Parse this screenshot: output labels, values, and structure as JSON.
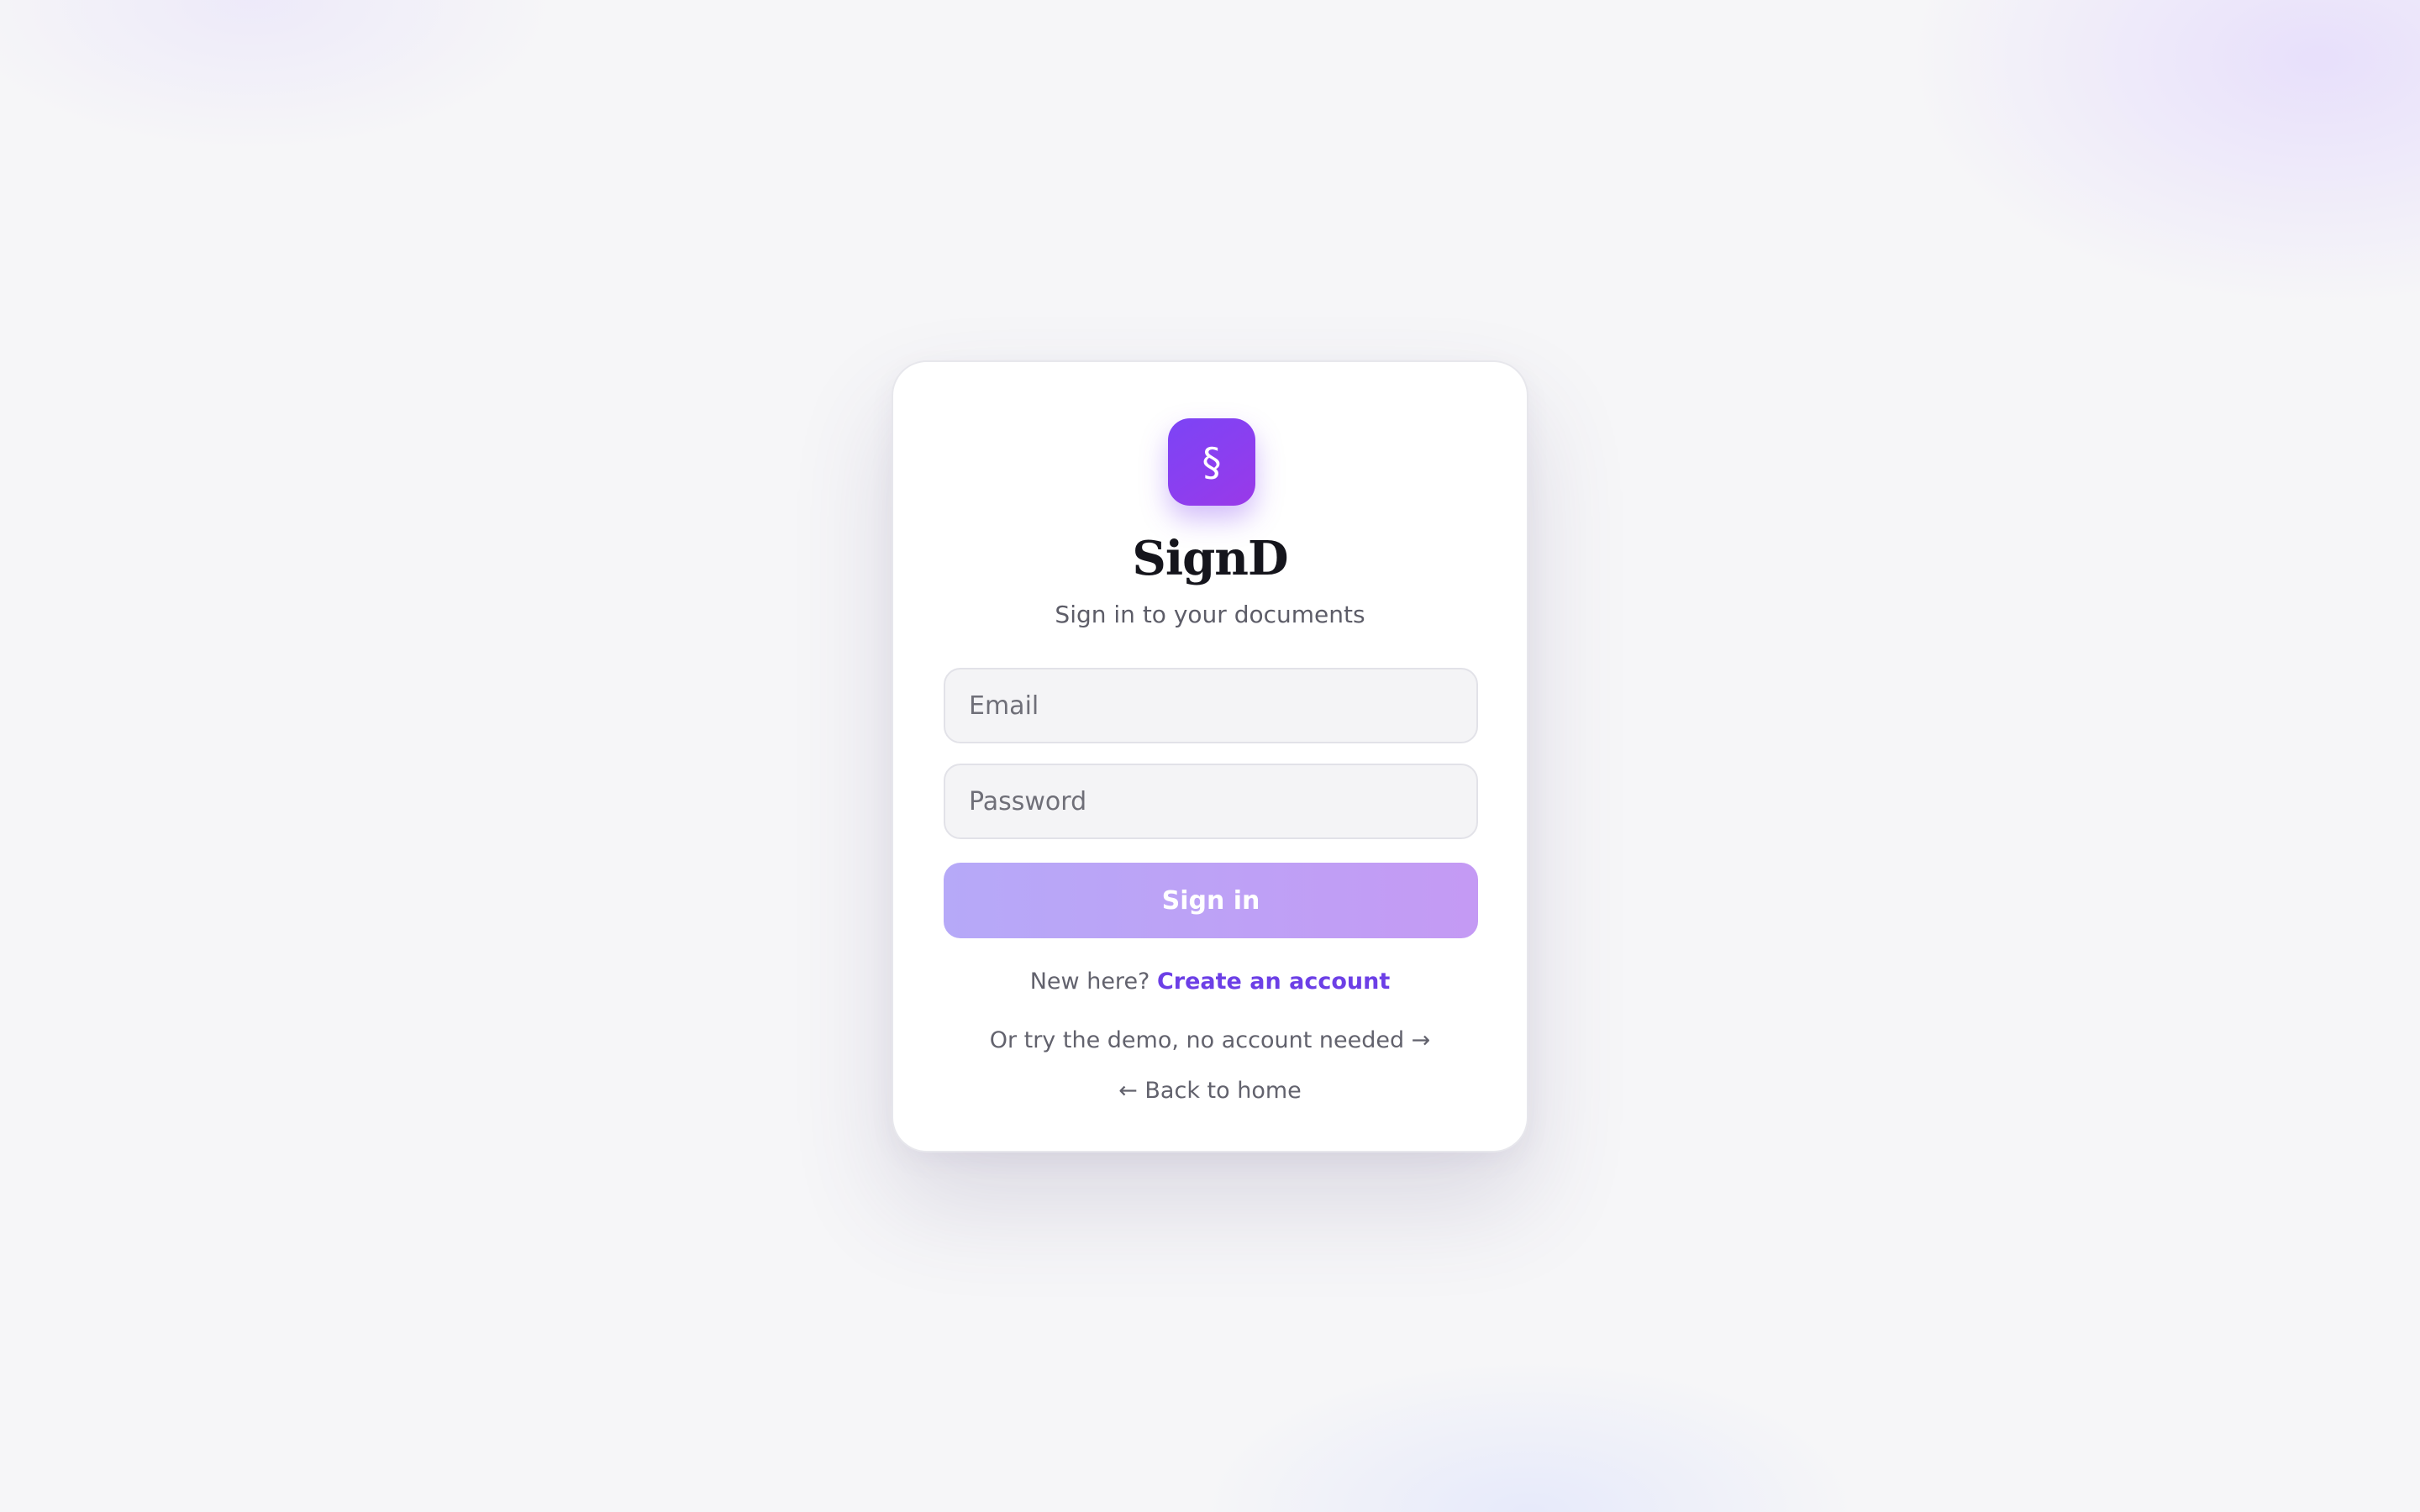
{
  "app": {
    "logo_glyph": "§",
    "logo_icon": "section-sign-icon",
    "name": "SignD",
    "subtitle": "Sign in to your documents"
  },
  "form": {
    "email_placeholder": "Email",
    "password_placeholder": "Password",
    "submit_label": "Sign in"
  },
  "footer": {
    "new_here_text": "New here?",
    "create_account_label": "Create an account",
    "demo_label": "Or try the demo, no account needed →",
    "back_label": "← Back to home"
  },
  "colors": {
    "accent": "#7c44f5",
    "link": "#6c3fe6",
    "button_gradient_start": "#b6a9f8",
    "button_gradient_end": "#c49af4"
  }
}
